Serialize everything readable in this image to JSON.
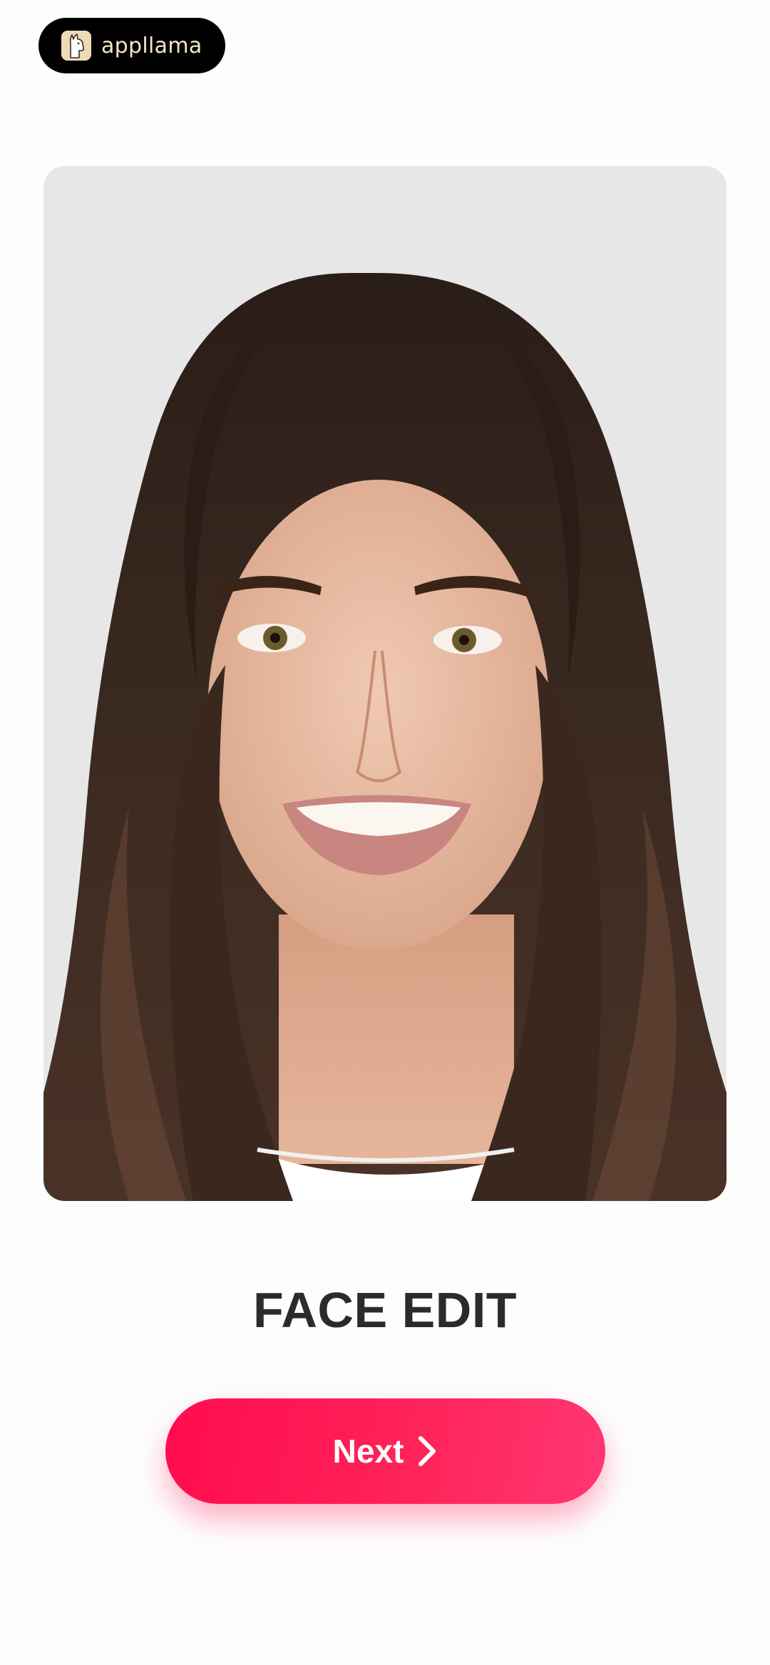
{
  "brand": {
    "name": "appllama",
    "logo_icon": "llama-icon"
  },
  "photo": {
    "alt": "portrait-photo"
  },
  "title": "FACE EDIT",
  "next_button": {
    "label": "Next",
    "icon": "chevron-right-icon"
  },
  "colors": {
    "accent": "#ff1f56",
    "title": "#2b2b2b",
    "badge_bg": "#000000",
    "badge_text": "#f4e4cc"
  }
}
